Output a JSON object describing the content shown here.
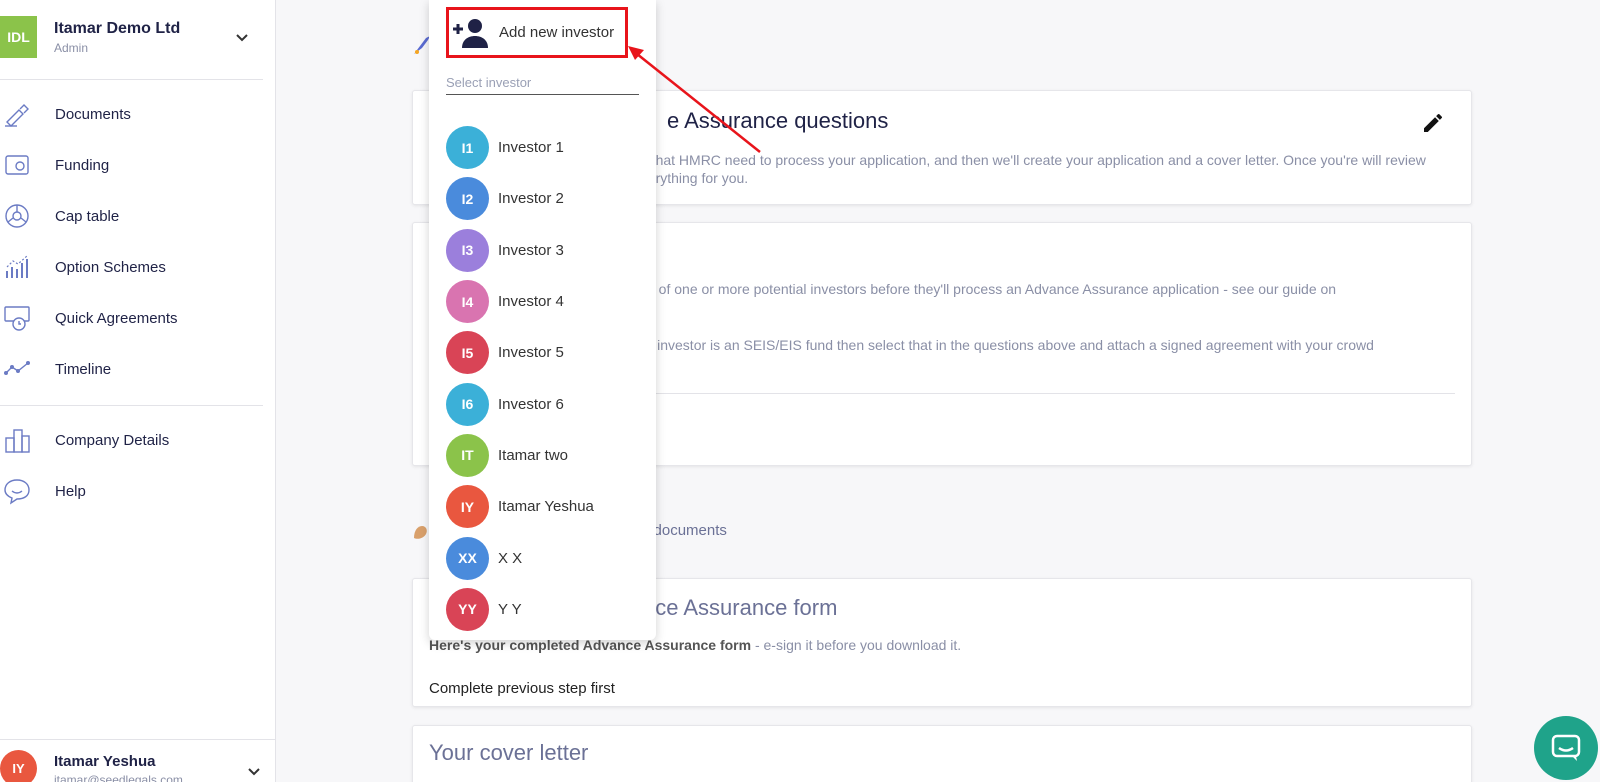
{
  "company": {
    "initials": "IDL",
    "name": "Itamar Demo Ltd",
    "role": "Admin",
    "color": "#8bc34a"
  },
  "nav": {
    "items": [
      {
        "label": "Documents",
        "icon": "pen-icon"
      },
      {
        "label": "Funding",
        "icon": "wallet-icon"
      },
      {
        "label": "Cap table",
        "icon": "pie-chart-icon"
      },
      {
        "label": "Option Schemes",
        "icon": "bar-chart-icon"
      },
      {
        "label": "Quick Agreements",
        "icon": "stopwatch-icon"
      },
      {
        "label": "Timeline",
        "icon": "timeline-icon"
      }
    ],
    "secondary": [
      {
        "label": "Company Details",
        "icon": "buildings-icon"
      },
      {
        "label": "Help",
        "icon": "chat-bubble-icon"
      }
    ]
  },
  "user": {
    "initials": "IY",
    "name": "Itamar Yeshua",
    "email": "itamar@seedlegals.com",
    "color": "#e9573f"
  },
  "main": {
    "card1": {
      "title": "e Assurance questions",
      "description": "gs that HMRC need to process your application, and then we'll create your application and a cover letter. Once you're will review everything for you."
    },
    "card2": {
      "p1": "ess of one or more potential investors before they'll process an Advance Assurance application - see our guide on",
      "p2": "our investor is an SEIS/EIS fund then select that in the questions above and attach a signed agreement with your crowd"
    },
    "section_label": "ur documents",
    "card3": {
      "title": "nce Assurance form",
      "desc_bold": "Here's your completed Advance Assurance form",
      "desc_rest": " - e-sign it before you download it.",
      "note": "Complete previous step first"
    },
    "card4": {
      "title": "Your cover letter"
    }
  },
  "dropdown": {
    "add_label": "Add new investor",
    "search_placeholder": "Select investor",
    "investors": [
      {
        "initials": "I1",
        "name": "Investor 1",
        "color": "#3bb0d8"
      },
      {
        "initials": "I2",
        "name": "Investor 2",
        "color": "#4a8bdc"
      },
      {
        "initials": "I3",
        "name": "Investor 3",
        "color": "#9b7fdc"
      },
      {
        "initials": "I4",
        "name": "Investor 4",
        "color": "#d974b0"
      },
      {
        "initials": "I5",
        "name": "Investor 5",
        "color": "#d94456"
      },
      {
        "initials": "I6",
        "name": "Investor 6",
        "color": "#3bb0d8"
      },
      {
        "initials": "IT",
        "name": "Itamar two",
        "color": "#8bc34a"
      },
      {
        "initials": "IY",
        "name": "Itamar Yeshua",
        "color": "#e9573f"
      },
      {
        "initials": "XX",
        "name": "X X",
        "color": "#4a8bdc"
      },
      {
        "initials": "YY",
        "name": "Y Y",
        "color": "#d94456"
      }
    ]
  },
  "colors": {
    "highlight": "#e8141b",
    "navy": "#1f2246",
    "chat": "#1fa38a"
  }
}
